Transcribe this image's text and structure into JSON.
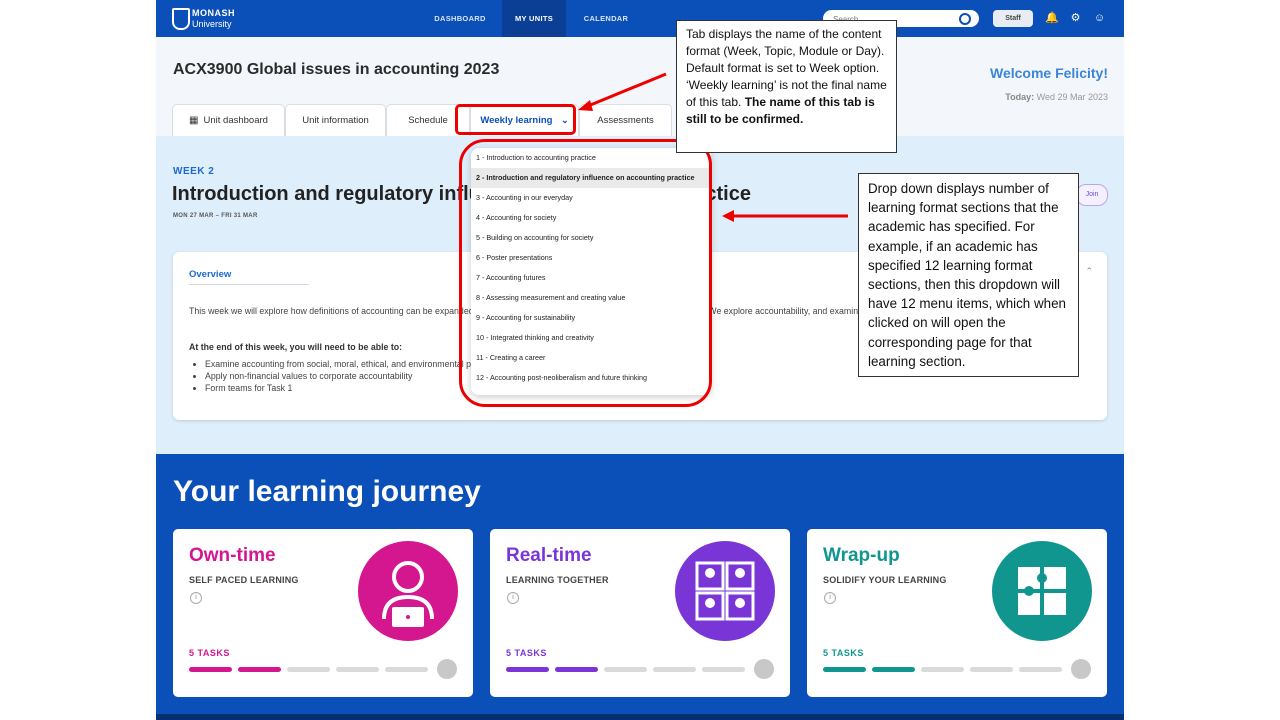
{
  "nav": {
    "logo_line1": "MONASH",
    "logo_line2": "University",
    "tabs": [
      "DASHBOARD",
      "MY UNITS",
      "CALENDAR"
    ],
    "active_tab": "MY UNITS",
    "search_placeholder": "Search",
    "staff_label": "Staff",
    "icons": [
      "bell-icon",
      "gear-icon",
      "user-icon"
    ]
  },
  "header": {
    "unit_title": "ACX3900 Global issues in accounting 2023",
    "welcome": "Welcome Felicity!",
    "today_label": "Today:",
    "today_date": "Wed 29 Mar 2023"
  },
  "unit_tabs": [
    "Unit dashboard",
    "Unit information",
    "Schedule",
    "Weekly learning",
    "Assessments"
  ],
  "week": {
    "label": "WEEK 2",
    "title": "Introduction and regulatory influence on accounting practice",
    "dates": "MON 27 MAR – FRI 31 MAR",
    "side_button": "Join"
  },
  "overview": {
    "tab": "Overview",
    "text": "This week we will explore how definitions of accounting can be expanded to include social, moral, ethical and environmental aspects. We explore accountability, and examine the changing accounting and accountability landscape.",
    "heading": "At the end of this week, you will need to be able to:",
    "bullets": [
      "Examine accounting from social, moral, ethical, and environmental perspectives",
      "Apply non-financial values to corporate accountability",
      "Form teams for Task 1"
    ]
  },
  "dropdown": {
    "items": [
      "1 - Introduction to accounting practice",
      "2 - Introduction and regulatory influence on accounting practice",
      "3 - Accounting in our everyday",
      "4 - Accounting for society",
      "5 - Building on accounting for society",
      "6 - Poster presentations",
      "7 - Accounting futures",
      "8 - Assessing measurement and creating value",
      "9 - Accounting for sustainability",
      "10 - Integrated thinking and creativity",
      "11 - Creating a career",
      "12 - Accounting post-neoliberalism and future thinking"
    ],
    "highlighted_index": 1
  },
  "journey": {
    "title": "Your learning journey",
    "cards": [
      {
        "title": "Own-time",
        "subtitle": "SELF PACED LEARNING",
        "tasks": "5 TASKS",
        "color": "#d4178f",
        "icon": "person-laptop-icon",
        "progress_done": 2,
        "progress_total": 5
      },
      {
        "title": "Real-time",
        "subtitle": "LEARNING TOGETHER",
        "tasks": "5 TASKS",
        "color": "#7a35d6",
        "icon": "video-call-icon",
        "progress_done": 2,
        "progress_total": 5
      },
      {
        "title": "Wrap-up",
        "subtitle": "SOLIDIFY YOUR LEARNING",
        "tasks": "5 TASKS",
        "color": "#10968f",
        "icon": "puzzle-icon",
        "progress_done": 2,
        "progress_total": 5
      }
    ]
  },
  "callouts": {
    "tab_note": "Tab displays the name of the content format (Week, Topic, Module or Day). Default format is set to Week option. ‘Weekly learning’ is not the final name of this tab.",
    "tab_note_bold": "The name of this tab is still to be confirmed.",
    "dropdown_note": "Drop down displays number of learning format sections that the academic has specified. For example, if an academic has specified 12 learning format sections, then this dropdown  will have 12 menu items, which when clicked on will open the corresponding page for that learning section."
  },
  "colors": {
    "brand_blue": "#0b4fb8",
    "annotation_red": "#ee0000",
    "week_bg": "#dfeefb"
  }
}
